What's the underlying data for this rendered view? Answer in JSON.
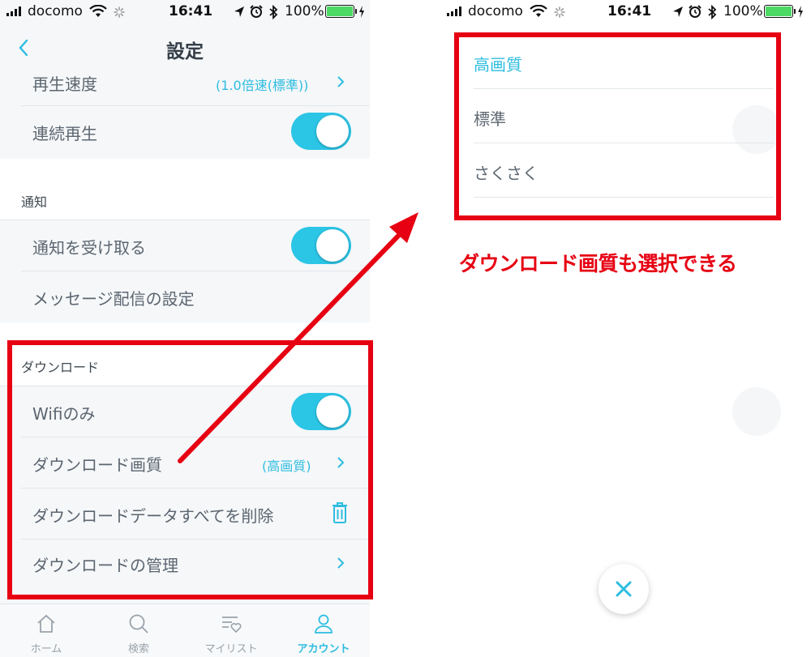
{
  "status_bar": {
    "carrier": "docomo",
    "time": "16:41",
    "battery": "100%"
  },
  "settings_screen": {
    "title": "設定",
    "playback_speed": {
      "label": "再生速度",
      "value": "(1.0倍速(標準))"
    },
    "continuous_play": {
      "label": "連続再生",
      "on": true
    },
    "notifications": {
      "header": "通知",
      "receive": {
        "label": "通知を受け取る",
        "on": true
      },
      "message_settings": {
        "label": "メッセージ配信の設定"
      }
    },
    "download": {
      "header": "ダウンロード",
      "wifi_only": {
        "label": "Wifiのみ",
        "on": true
      },
      "quality": {
        "label": "ダウンロード画質",
        "value": "(高画質)"
      },
      "delete_all": {
        "label": "ダウンロードデータすべてを削除"
      },
      "manage": {
        "label": "ダウンロードの管理"
      }
    }
  },
  "tab_bar": {
    "tabs": [
      {
        "label": "ホーム",
        "icon": "home-icon",
        "active": false
      },
      {
        "label": "検索",
        "icon": "search-icon",
        "active": false
      },
      {
        "label": "マイリスト",
        "icon": "mylist-icon",
        "active": false
      },
      {
        "label": "アカウント",
        "icon": "account-icon",
        "active": true
      }
    ]
  },
  "quality_picker": {
    "options": [
      {
        "label": "高画質",
        "selected": true
      },
      {
        "label": "標準",
        "selected": false
      },
      {
        "label": "さくさく",
        "selected": false
      }
    ]
  },
  "annotation": {
    "caption": "ダウンロード画質も選択できる"
  },
  "colors": {
    "accent": "#2dbde0",
    "highlight_red": "#e60012",
    "toggle_on": "#2bc5e6",
    "battery_green": "#4cd964"
  }
}
